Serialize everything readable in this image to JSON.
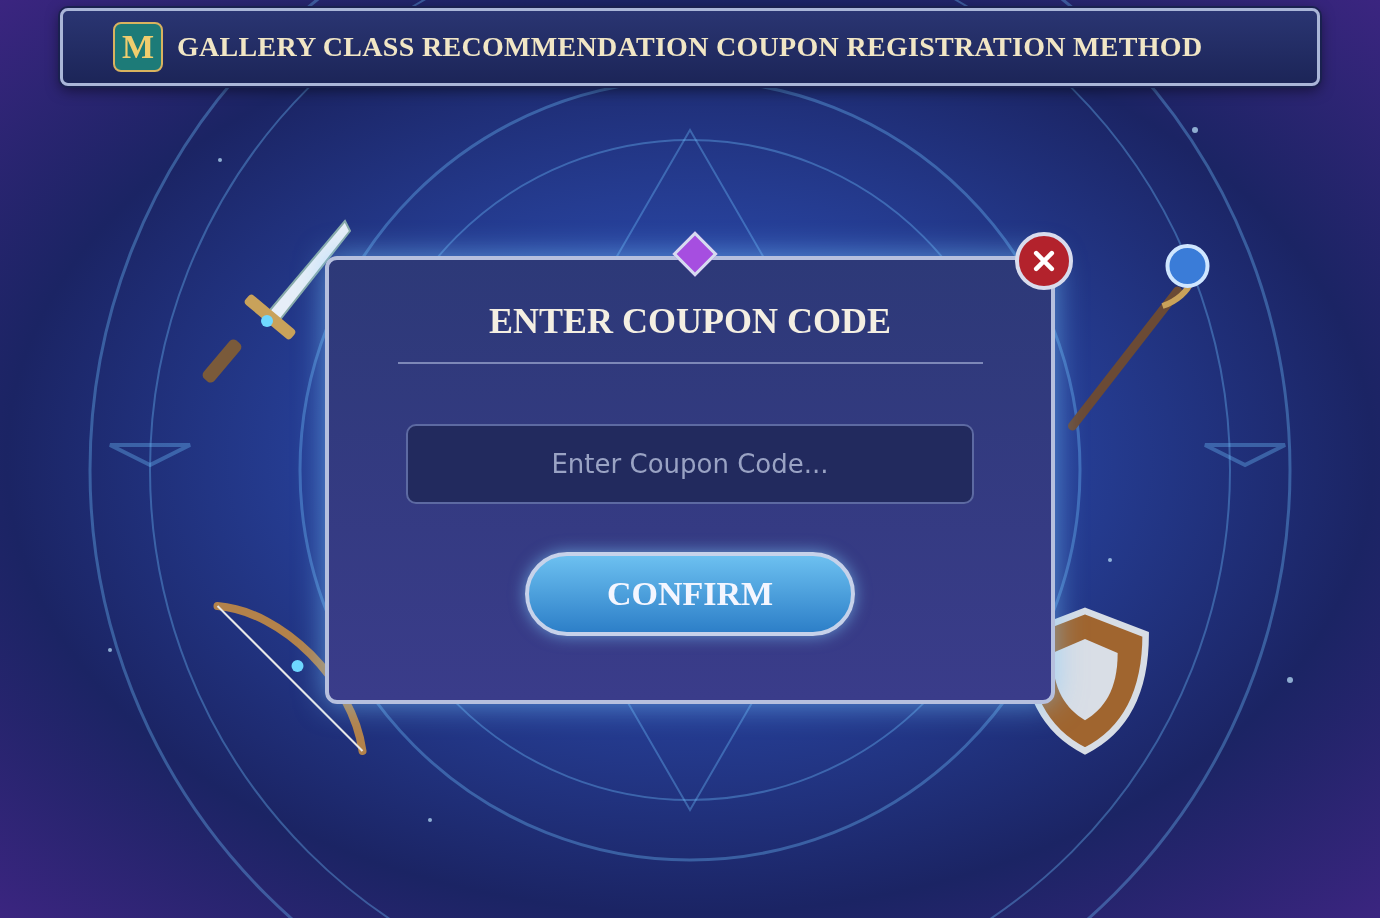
{
  "header": {
    "logo": "M",
    "title": "GALLERY CLASS RECOMMENDATION COUPON REGISTRATION METHOD"
  },
  "dialog": {
    "title": "ENTER COUPON CODE",
    "coupon_field": {
      "placeholder": "Enter Coupon Code..."
    },
    "confirm_button": "CONFIRM"
  }
}
